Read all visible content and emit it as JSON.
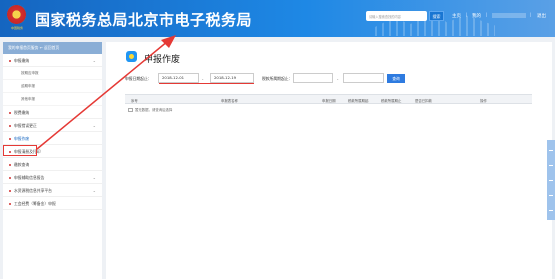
{
  "header": {
    "emblem_caption": "中国税务",
    "title": "国家税务总局北京市电子税务局",
    "search_placeholder": "请输入搜索查找的内容",
    "search_button": "搜索",
    "links": [
      "主页",
      "我的",
      "退出"
    ]
  },
  "sidebar": {
    "head": "我的申报首页服务 ← 返回首页",
    "items": [
      {
        "label": "申报缴纳",
        "chevron": "⌄",
        "expanded": true
      },
      {
        "label": "按期应申报",
        "sub": true
      },
      {
        "label": "逾期申报",
        "sub": true
      },
      {
        "label": "其他申报",
        "sub": true
      },
      {
        "label": "税费缴纳",
        "chevron": ""
      },
      {
        "label": "申报错误更正",
        "chevron": "⌄"
      },
      {
        "label": "申报作废",
        "chevron": "",
        "active": true
      },
      {
        "label": "申报清册及打印",
        "chevron": ""
      },
      {
        "label": "缴款查询",
        "chevron": ""
      },
      {
        "label": "申报辅助信息报告",
        "chevron": "⌄"
      },
      {
        "label": "水资源税信息共享平台",
        "chevron": "⌄"
      },
      {
        "label": "工会经费（筹备金）申报",
        "chevron": ""
      }
    ]
  },
  "main": {
    "title": "申报作废",
    "form": {
      "date_label": "申报日期起止：",
      "date_start": "2018-12-01",
      "date_sep": "-",
      "date_end": "2018-12-19",
      "period_label": "税款所属期起止：",
      "period_start": "",
      "period_sep": "-",
      "period_end": "",
      "query_button": "查询"
    },
    "table": {
      "columns": [
        "序号",
        "申报表名称",
        "申报日期",
        "税款所属期起",
        "税款所属期止",
        "是否已扣款",
        "操作"
      ],
      "empty_text": "暂无数据，请查询后选择"
    }
  },
  "colors": {
    "header_blue": "#1565c0",
    "annotation_red": "#e53935",
    "query_blue": "#2e7be0"
  }
}
